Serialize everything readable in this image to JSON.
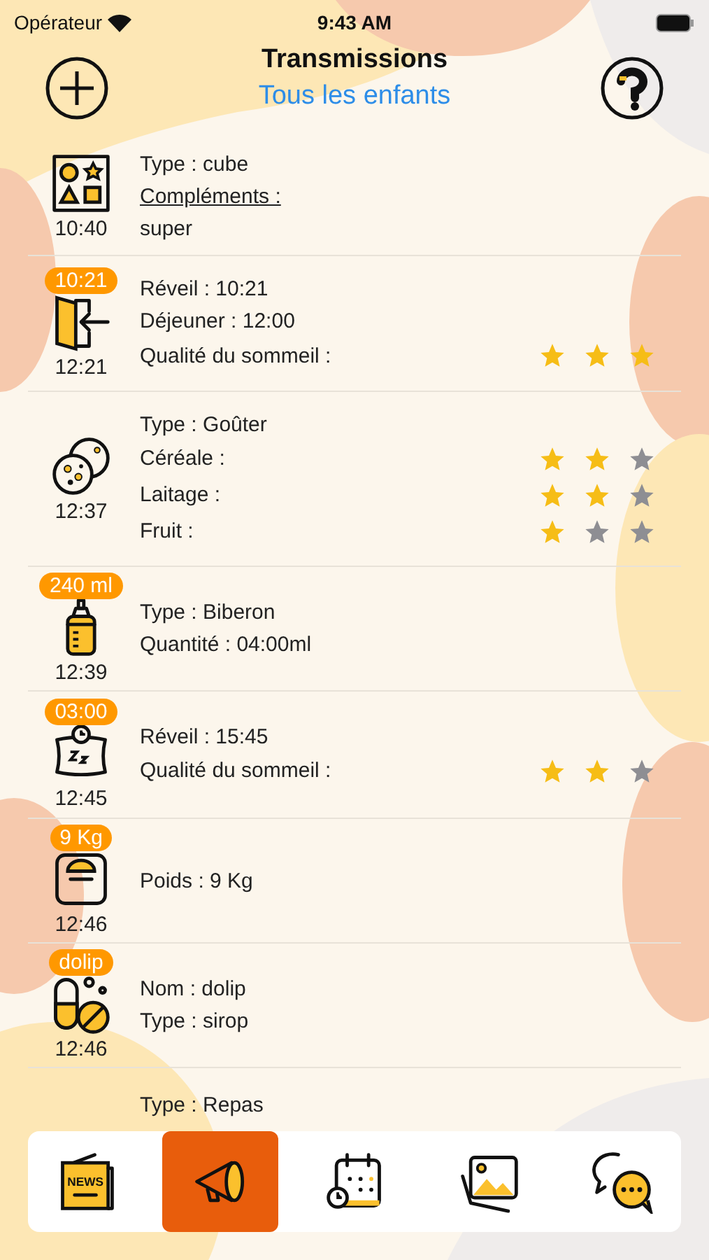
{
  "status_bar": {
    "carrier": "Opérateur",
    "time": "9:43 AM"
  },
  "header": {
    "title": "Transmissions",
    "subtitle": "Tous les enfants"
  },
  "entries": [
    {
      "kind": "toys",
      "time": "10:40",
      "lines": [
        {
          "text": "Type : cube"
        },
        {
          "text": "Compléments :",
          "kind": "heading"
        },
        {
          "text": "super"
        }
      ]
    },
    {
      "kind": "door",
      "time": "12:21",
      "badge": "10:21",
      "lines": [
        {
          "text": "Réveil : 10:21"
        },
        {
          "text": "Déjeuner : 12:00"
        },
        {
          "text": "Qualité du sommeil :",
          "stars": 3
        }
      ]
    },
    {
      "kind": "cookies",
      "time": "12:37",
      "lines": [
        {
          "text": "Type : Goûter"
        },
        {
          "text": "Céréale :",
          "stars": 2
        },
        {
          "text": "Laitage :",
          "stars": 2
        },
        {
          "text": "Fruit :",
          "stars": 1
        }
      ]
    },
    {
      "kind": "bottle",
      "time": "12:39",
      "badge": "240 ml",
      "lines": [
        {
          "text": "Type : Biberon"
        },
        {
          "text": "Quantité : 04:00ml"
        }
      ]
    },
    {
      "kind": "sleep",
      "time": "12:45",
      "badge": "03:00",
      "lines": [
        {
          "text": "Réveil : 15:45"
        },
        {
          "text": "Qualité du sommeil :",
          "stars": 2
        }
      ]
    },
    {
      "kind": "scale",
      "time": "12:46",
      "badge": "9 Kg",
      "lines": [
        {
          "text": "Poids : 9 Kg"
        }
      ]
    },
    {
      "kind": "pills",
      "time": "12:46",
      "badge": "dolip",
      "lines": [
        {
          "text": "Nom : dolip"
        },
        {
          "text": "Type : sirop"
        }
      ]
    },
    {
      "lines": [
        {
          "text": "Type : Repas"
        }
      ]
    }
  ],
  "tabs": [
    {
      "kind": "news",
      "icon_text": "NEWS",
      "selected": false
    },
    {
      "kind": "megaphone",
      "selected": true
    },
    {
      "kind": "calendar",
      "selected": false
    },
    {
      "kind": "pictures",
      "selected": false
    },
    {
      "kind": "chat",
      "selected": false
    }
  ]
}
